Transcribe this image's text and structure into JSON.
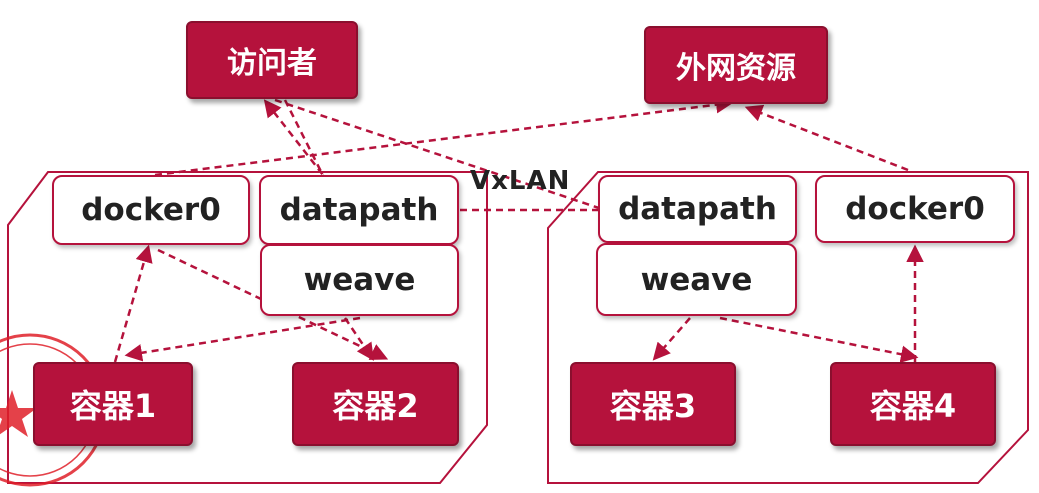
{
  "colors": {
    "accent": "#b5123c",
    "line": "#b5123c",
    "text_dark": "#222222"
  },
  "top": {
    "visitor": "访问者",
    "external": "外网资源"
  },
  "host_left": {
    "docker0": "docker0",
    "datapath": "datapath",
    "weave": "weave",
    "container_a": "容器1",
    "container_b": "容器2"
  },
  "host_right": {
    "docker0": "docker0",
    "datapath": "datapath",
    "weave": "weave",
    "container_a": "容器3",
    "container_b": "容器4"
  },
  "link_label": "VxLAN"
}
